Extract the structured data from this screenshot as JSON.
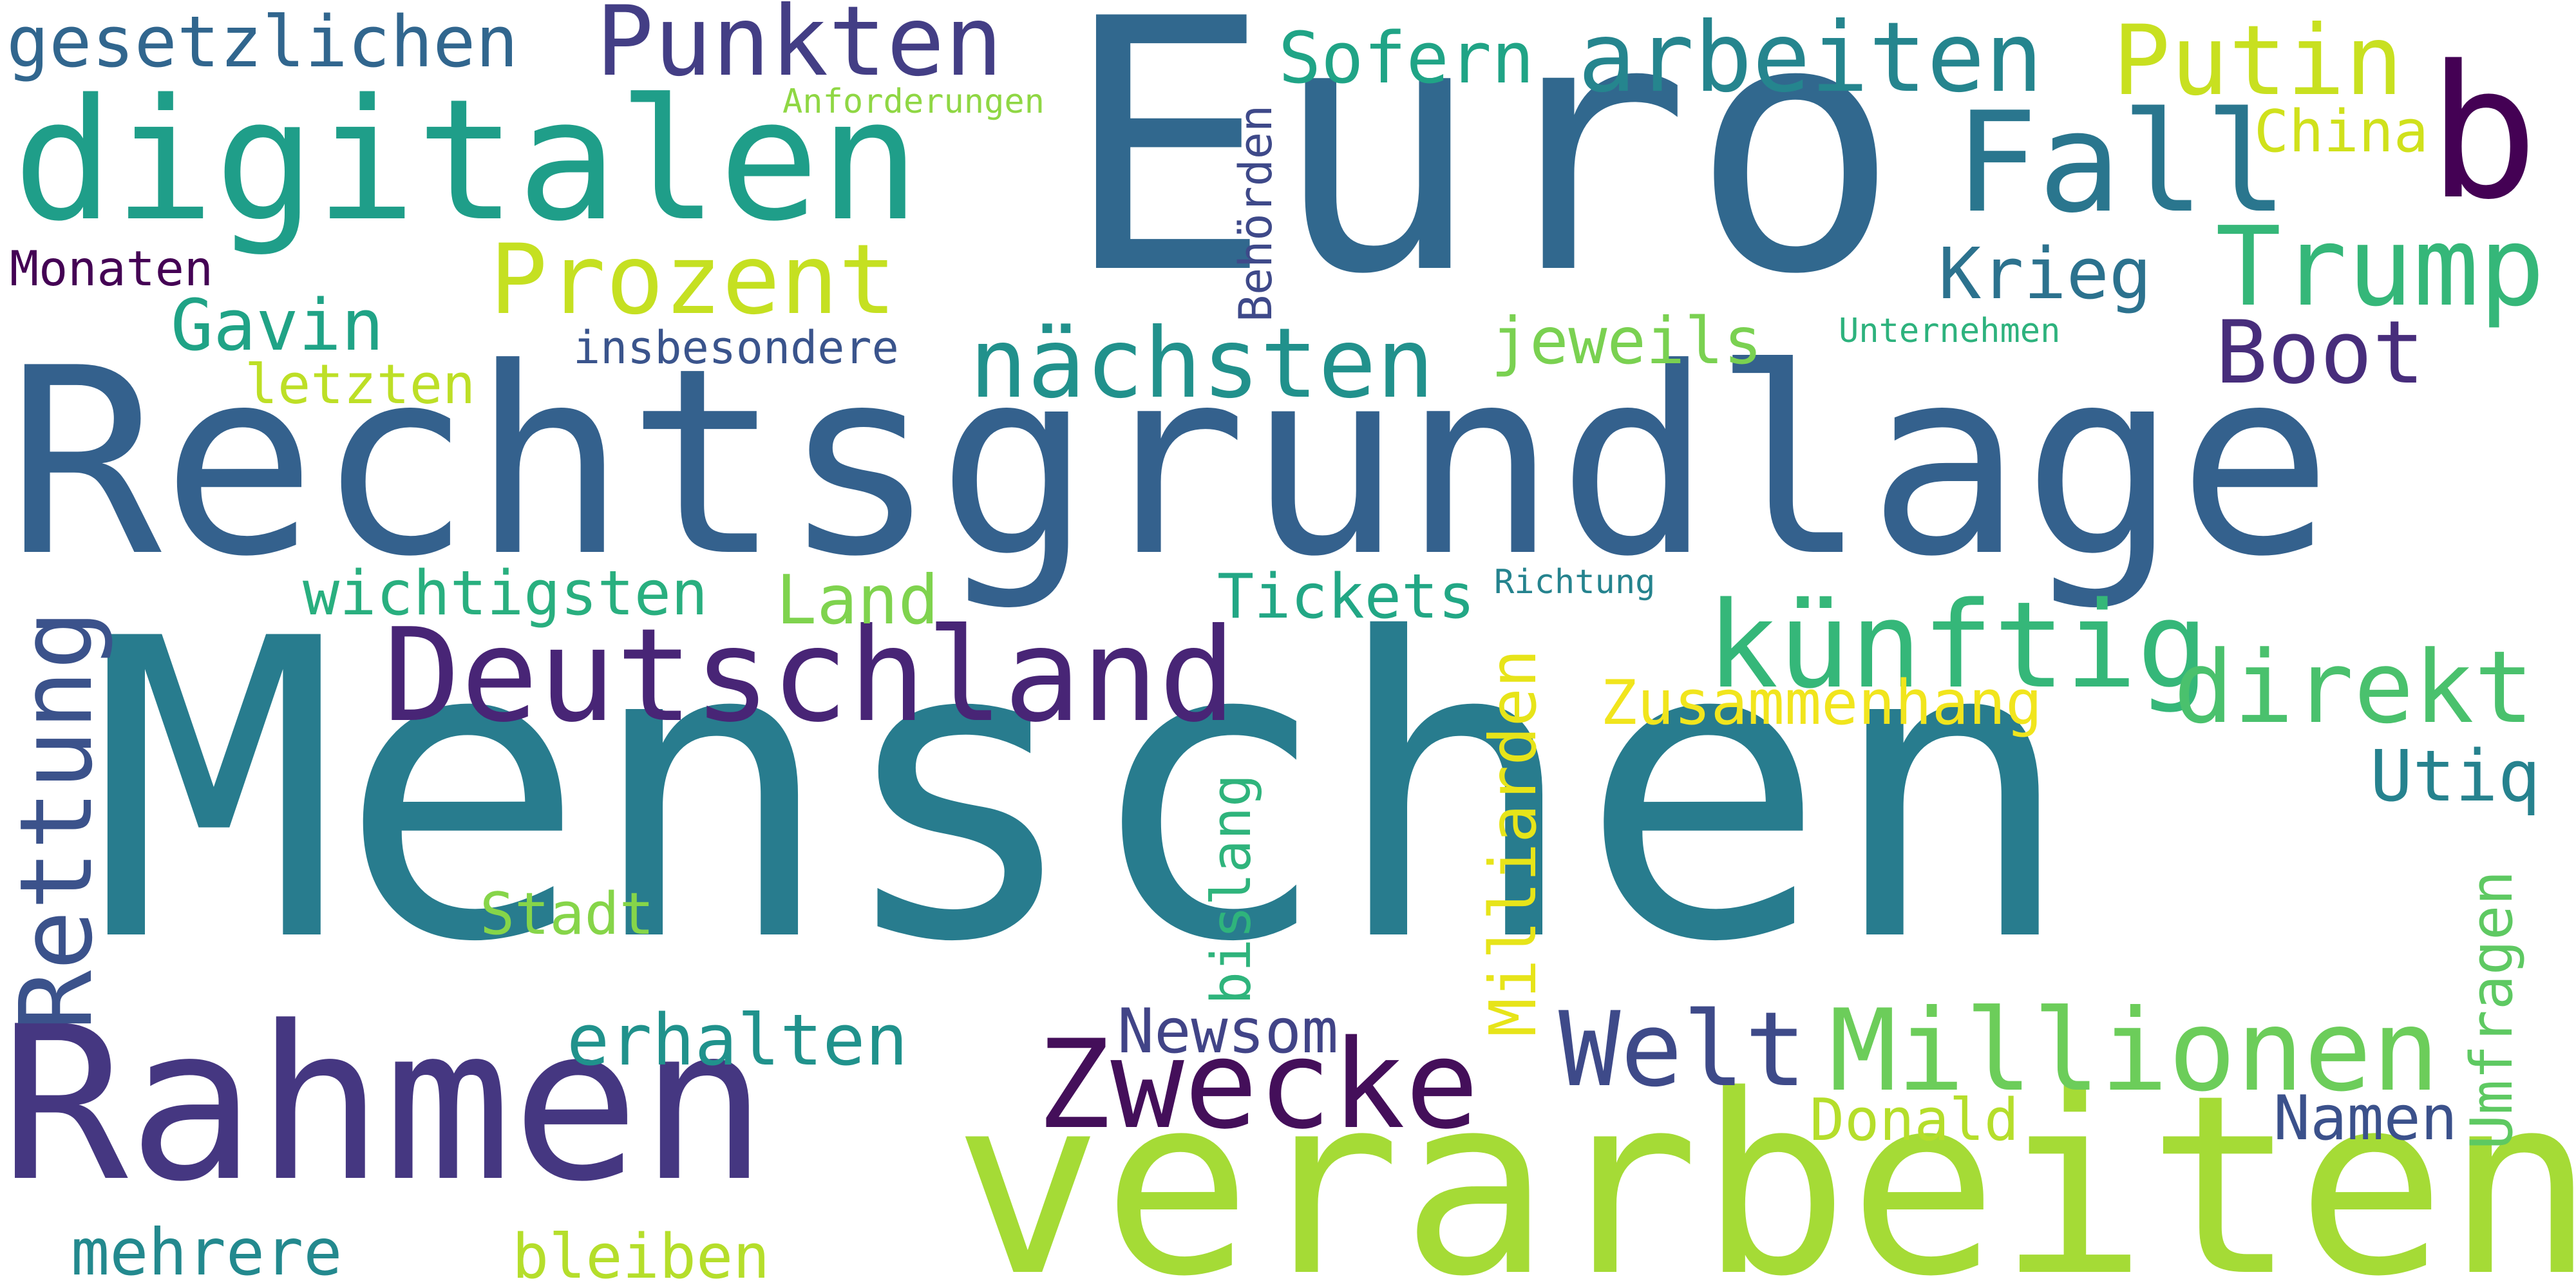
{
  "word_cloud": {
    "background": "#ffffff",
    "words": {
      "euro": {
        "text": "Euro",
        "color": "#31688e"
      },
      "rechtsgrundlage": {
        "text": "Rechtsgrundlage",
        "color": "#34618d"
      },
      "menschen": {
        "text": "Menschen",
        "color": "#287c8e"
      },
      "rahmen": {
        "text": "Rahmen",
        "color": "#453781"
      },
      "verarbeiten": {
        "text": "verarbeiten",
        "color": "#a5db36"
      },
      "digitalen": {
        "text": "digitalen",
        "color": "#1f9e89"
      },
      "b": {
        "text": "b",
        "color": "#440154"
      },
      "deutschland": {
        "text": "Deutschland",
        "color": "#482576"
      },
      "zwecke": {
        "text": "Zwecke",
        "color": "#440f5a"
      },
      "fall": {
        "text": "Fall",
        "color": "#2a768e"
      },
      "trump": {
        "text": "Trump",
        "color": "#35b779"
      },
      "kuenftig": {
        "text": "künftig",
        "color": "#35b779"
      },
      "millionen": {
        "text": "Millionen",
        "color": "#6ccd5a"
      },
      "welt": {
        "text": "Welt",
        "color": "#3e4a89"
      },
      "direkt": {
        "text": "direkt",
        "color": "#4ac16d"
      },
      "boot": {
        "text": "Boot",
        "color": "#472d7b"
      },
      "naechsten": {
        "text": "nächsten",
        "color": "#21918c"
      },
      "putin": {
        "text": "Putin",
        "color": "#c8e020"
      },
      "arbeiten": {
        "text": "arbeiten",
        "color": "#25858e"
      },
      "punkten": {
        "text": "Punkten",
        "color": "#433e85"
      },
      "prozent": {
        "text": "Prozent",
        "color": "#c5e021"
      },
      "gesetzlichen": {
        "text": "gesetzlichen",
        "color": "#31668e"
      },
      "sofern": {
        "text": "Sofern",
        "color": "#20a486"
      },
      "krieg": {
        "text": "Krieg",
        "color": "#2c728e"
      },
      "gavin": {
        "text": "Gavin",
        "color": "#20a386"
      },
      "jeweils": {
        "text": "jeweils",
        "color": "#7ad151"
      },
      "erhalten": {
        "text": "erhalten",
        "color": "#20928c"
      },
      "utiq": {
        "text": "Utiq",
        "color": "#26828e"
      },
      "namen": {
        "text": "Namen",
        "color": "#3b518b"
      },
      "donald": {
        "text": "Donald",
        "color": "#b5de2b"
      },
      "newsom": {
        "text": "Newsom",
        "color": "#414487"
      },
      "tickets": {
        "text": "Tickets",
        "color": "#22a785"
      },
      "land": {
        "text": "Land",
        "color": "#7fd34e"
      },
      "wichtigsten": {
        "text": "wichtigsten",
        "color": "#29af7f"
      },
      "zusammenhang": {
        "text": "Zusammenhang",
        "color": "#f1e51d"
      },
      "china": {
        "text": "China",
        "color": "#d0e11c"
      },
      "monaten": {
        "text": "Monaten",
        "color": "#440154"
      },
      "insbesondere": {
        "text": "insbesondere",
        "color": "#3a548c"
      },
      "letzten": {
        "text": "letzten",
        "color": "#bddf26"
      },
      "stadt": {
        "text": "Stadt",
        "color": "#86d549"
      },
      "mehrere": {
        "text": "mehrere",
        "color": "#23898e"
      },
      "bleiben": {
        "text": "bleiben",
        "color": "#b5de2b"
      },
      "anforderungen": {
        "text": "Anforderungen",
        "color": "#8fd744"
      },
      "unternehmen": {
        "text": "Unternehmen",
        "color": "#2db27d"
      },
      "richtung": {
        "text": "Richtung",
        "color": "#25838e"
      },
      "rettung": {
        "text": "Rettung",
        "color": "#3b528b"
      },
      "umfragen": {
        "text": "Umfragen",
        "color": "#5ec962"
      },
      "bislang": {
        "text": "bislang",
        "color": "#2fb47c"
      },
      "behoerden": {
        "text": "Behörden",
        "color": "#3e4989"
      },
      "milliarden": {
        "text": "Milliarden",
        "color": "#e7e419"
      }
    }
  }
}
